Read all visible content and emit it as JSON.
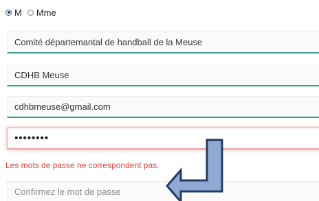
{
  "civility": {
    "options": [
      {
        "label": "M",
        "checked": true
      },
      {
        "label": "Mme",
        "checked": false
      }
    ]
  },
  "form": {
    "organization": "Comité départemantal de handball de la Meuse",
    "short_name": "CDHB Meuse",
    "email": "cdhbmeuse@gmail.com",
    "password_masked": "••••••••",
    "error_message": "Les mots de passe ne correspondent pas.",
    "confirm_placeholder": "Confirmez le mot de passe"
  },
  "colors": {
    "field_underline": "#3a9e8a",
    "error": "#e0453f",
    "arrow_fill": "#8fa9d2",
    "arrow_stroke": "#243a66"
  },
  "annotation": {
    "arrow_icon": "blue-arrow-icon"
  }
}
